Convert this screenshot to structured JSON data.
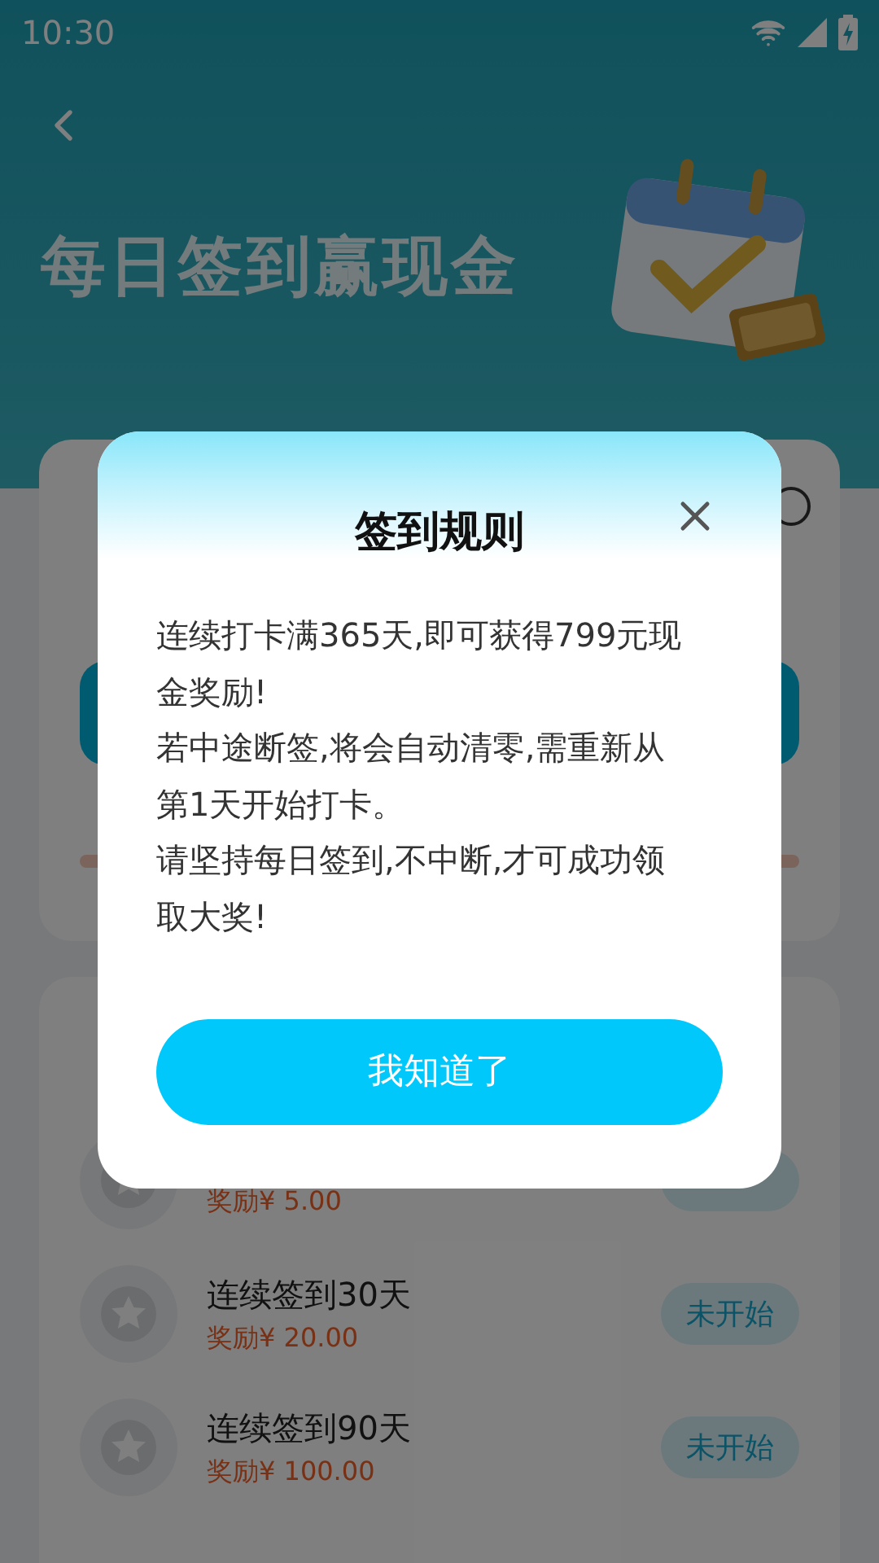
{
  "status_bar": {
    "time": "10:30"
  },
  "header": {
    "title": "每日签到赢现金"
  },
  "rewards_card": {
    "rows": [
      {
        "reward": "奖励¥ 5.00"
      },
      {
        "title": "连续签到30天",
        "reward": "奖励¥ 20.00",
        "status": "未开始"
      },
      {
        "title": "连续签到90天",
        "reward": "奖励¥ 100.00",
        "status": "未开始"
      }
    ]
  },
  "dialog": {
    "title": "签到规则",
    "paragraphs": [
      "连续打卡满365天,即可获得799元现金奖励!",
      "若中途断签,将会自动清零,需重新从第1天开始打卡。",
      "请坚持每日签到,不中断,才可成功领取大奖!"
    ],
    "button": "我知道了"
  }
}
